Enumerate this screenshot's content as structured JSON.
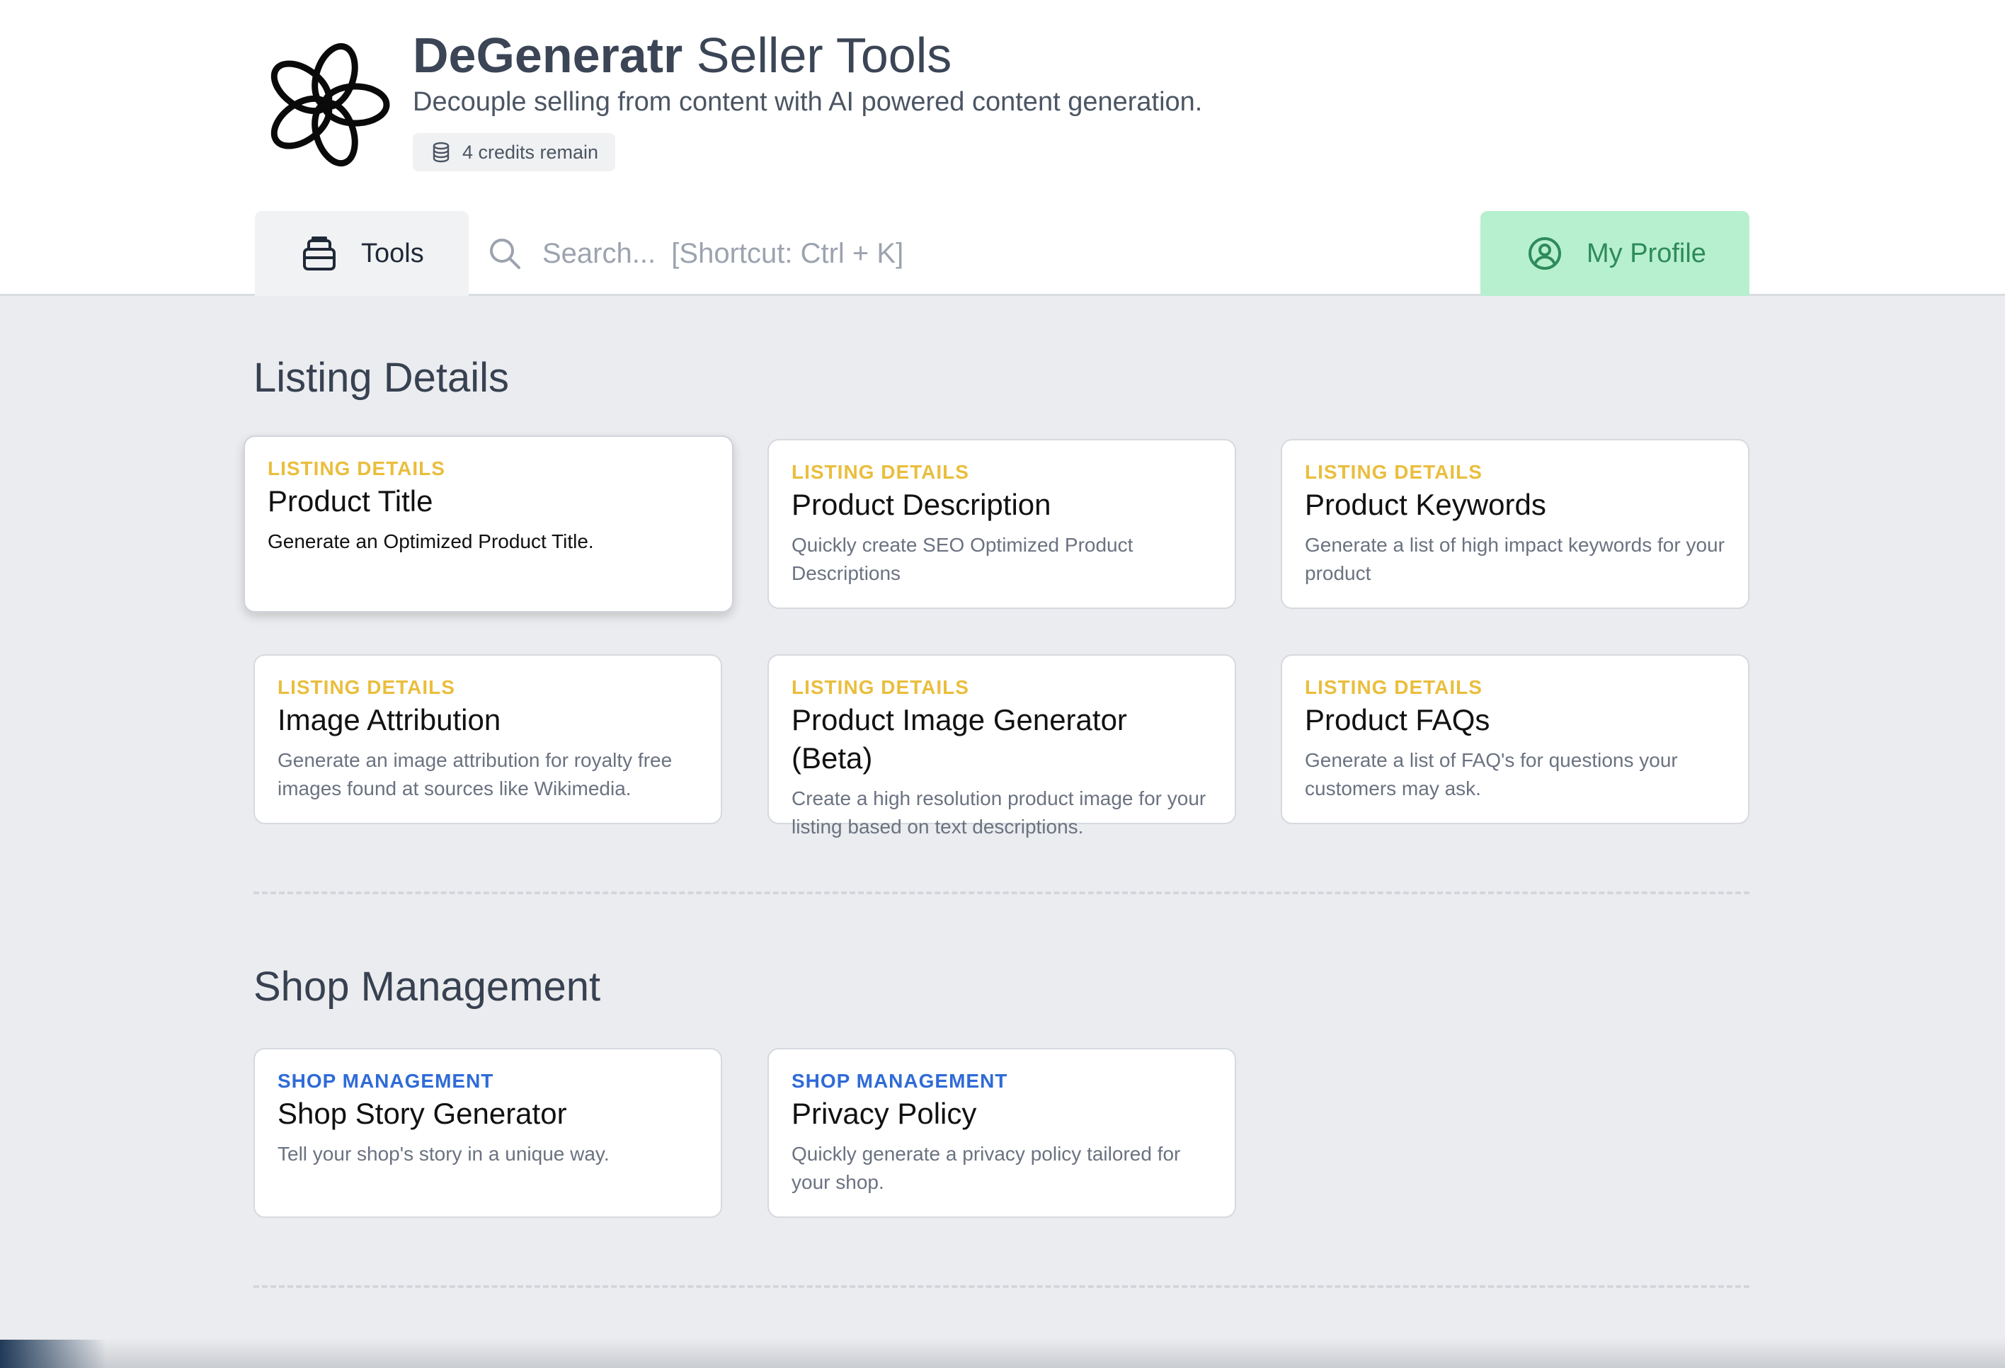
{
  "header": {
    "brand_strong": "DeGeneratr",
    "brand_rest": " Seller Tools",
    "subtitle": "Decouple selling from content with AI powered content generation.",
    "credits": "4 credits remain"
  },
  "nav": {
    "tools_label": "Tools",
    "search_placeholder": "Search...  [Shortcut: Ctrl + K]",
    "profile_label": "My Profile"
  },
  "sections": [
    {
      "title": "Listing Details",
      "cards": [
        {
          "category": "LISTING DETAILS",
          "title": "Product Title",
          "description": "Generate an Optimized Product Title."
        },
        {
          "category": "LISTING DETAILS",
          "title": "Product Description",
          "description": "Quickly create SEO Optimized Product Descriptions"
        },
        {
          "category": "LISTING DETAILS",
          "title": "Product Keywords",
          "description": "Generate a list of high impact keywords for your product"
        },
        {
          "category": "LISTING DETAILS",
          "title": "Image Attribution",
          "description": "Generate an image attribution for royalty free images found at sources like Wikimedia."
        },
        {
          "category": "LISTING DETAILS",
          "title": "Product Image Generator (Beta)",
          "description": "Create a high resolution product image for your listing based on text descriptions."
        },
        {
          "category": "LISTING DETAILS",
          "title": "Product FAQs",
          "description": "Generate a list of FAQ's for questions your customers may ask."
        }
      ]
    },
    {
      "title": "Shop Management",
      "cards": [
        {
          "category": "SHOP MANAGEMENT",
          "title": "Shop Story Generator",
          "description": "Tell your shop's story in a unique way."
        },
        {
          "category": "SHOP MANAGEMENT",
          "title": "Privacy Policy",
          "description": "Quickly generate a privacy policy tailored for your shop."
        }
      ]
    }
  ],
  "icons": {
    "logo": "flower-logo-icon",
    "credits": "database-icon",
    "tools": "toolbox-icon",
    "search": "search-icon",
    "profile": "user-circle-icon"
  },
  "colors": {
    "listing_accent": "#eabe3d",
    "shop_accent": "#2f6bd8",
    "profile_bg": "#b7f0cf",
    "profile_text": "#2e8a5a"
  }
}
